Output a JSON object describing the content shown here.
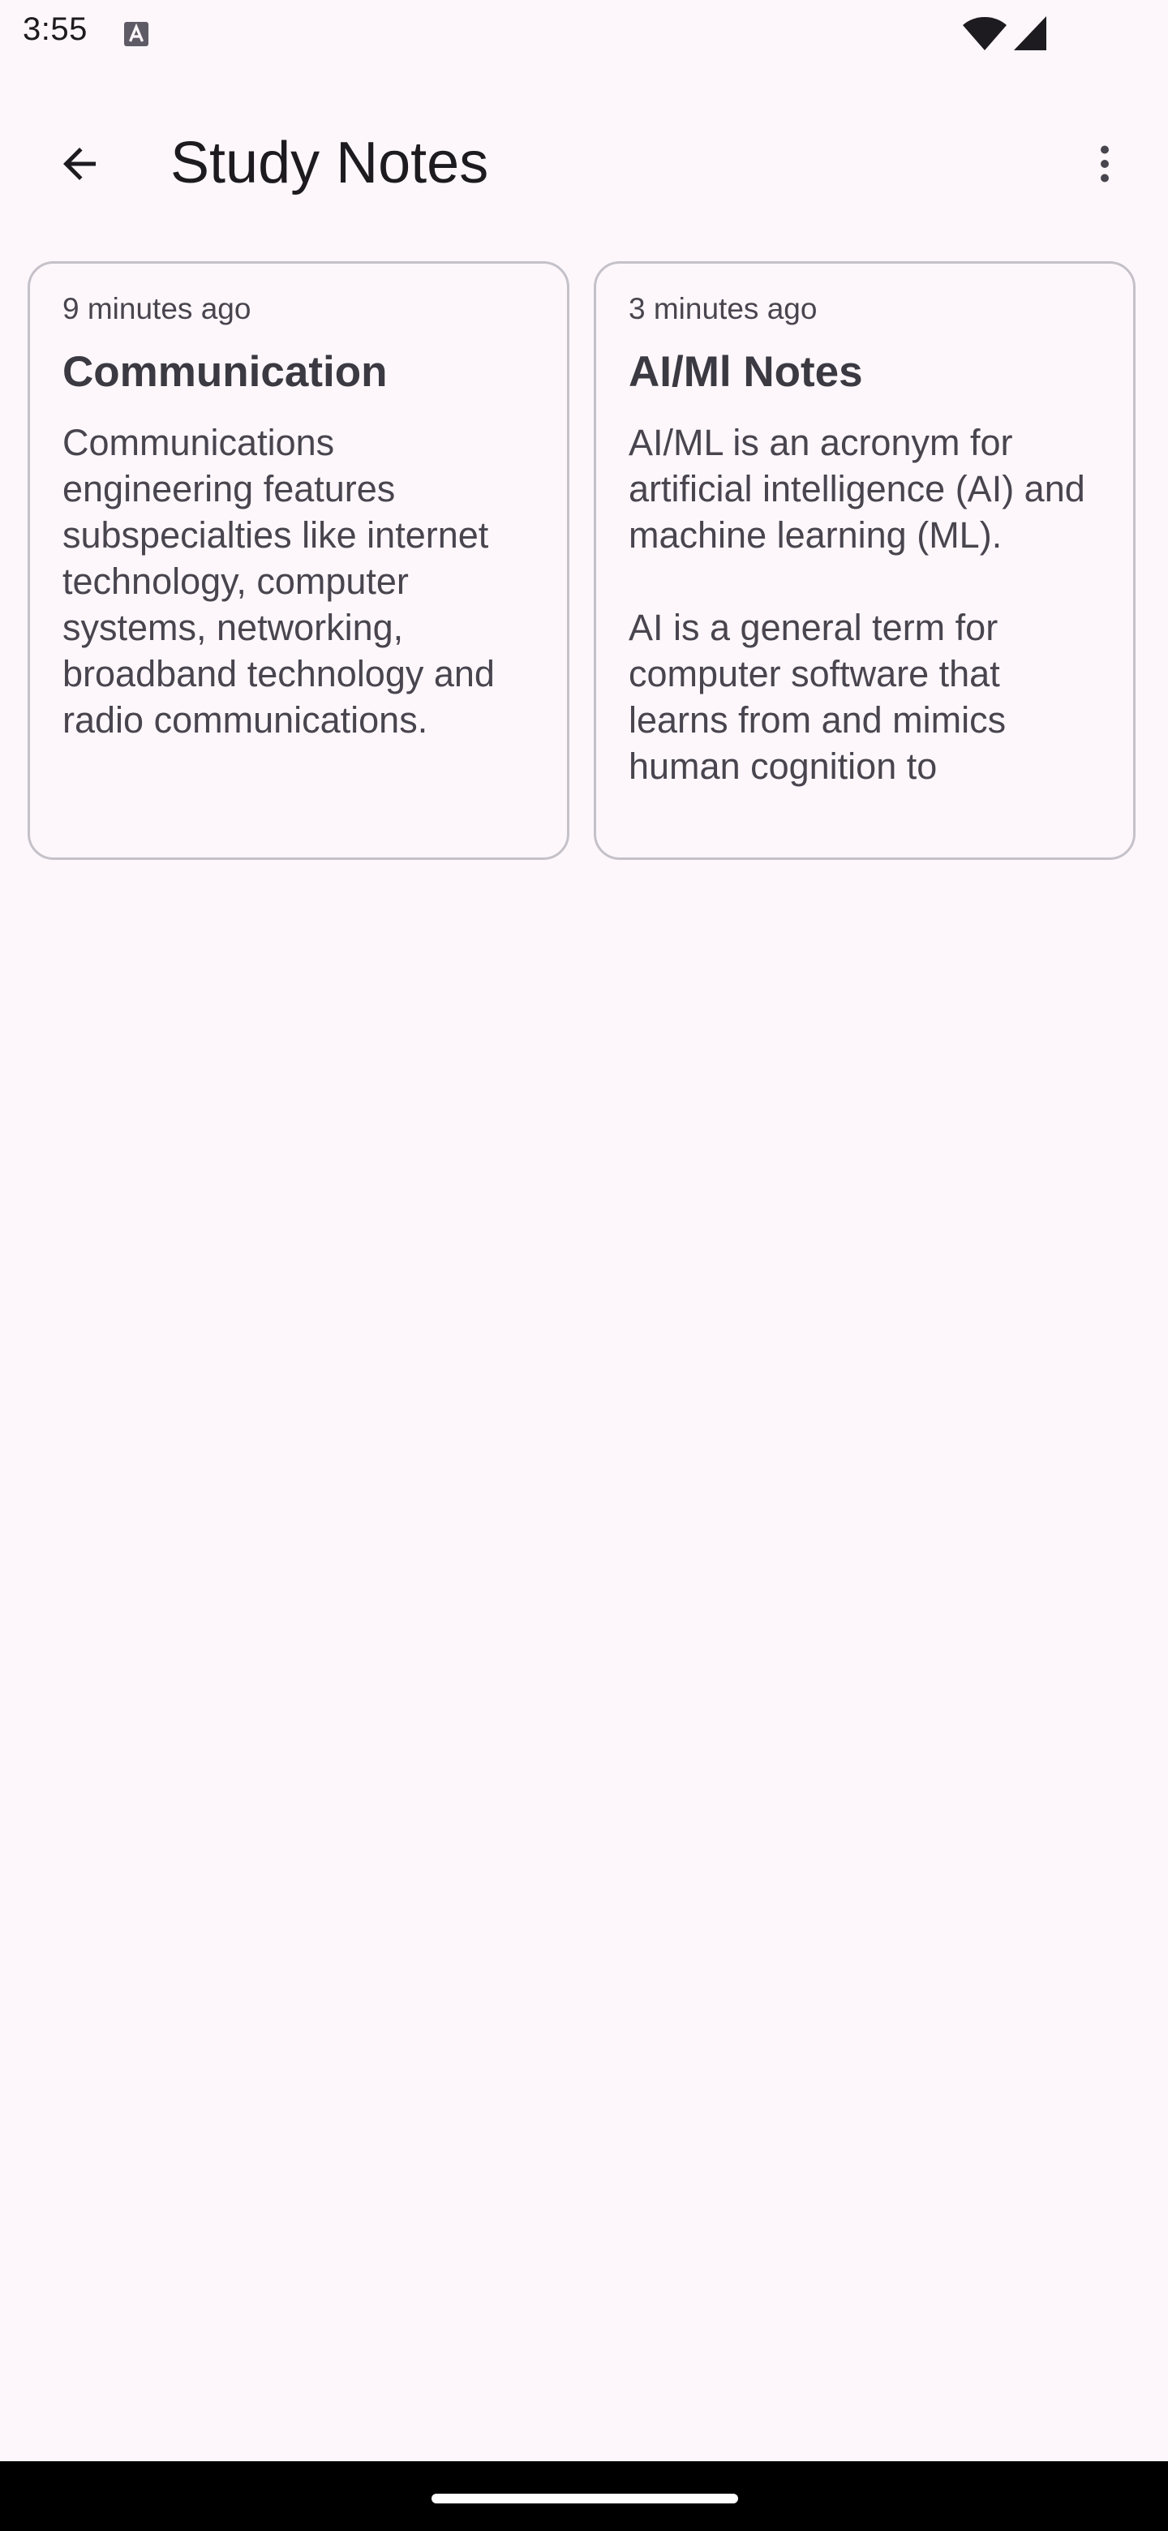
{
  "status_bar": {
    "time": "3:55",
    "icons": [
      "a-notification-icon",
      "wifi-icon",
      "cellular-signal-icon"
    ]
  },
  "app_bar": {
    "back_icon": "arrow-back-icon",
    "title": "Study Notes",
    "menu_icon": "more-vert-icon"
  },
  "notes": [
    {
      "time": "9 minutes ago",
      "title": "Communication",
      "body": "Communications engineering features subspecialties like internet technology, computer systems, networking, broadband technology and radio communications."
    },
    {
      "time": "3 minutes ago",
      "title": "AI/Ml Notes",
      "body": "AI/ML is an acronym for artificial intelligence (AI) and machine learning (ML).\n\nAI is a general term for computer software that learns from and mimics human cognition to"
    }
  ],
  "colors": {
    "background": "#fdf7fb",
    "card_border": "#c4c1c9",
    "text_primary": "#1d1b20",
    "text_secondary": "#49454f",
    "nav_bar": "#000000"
  }
}
